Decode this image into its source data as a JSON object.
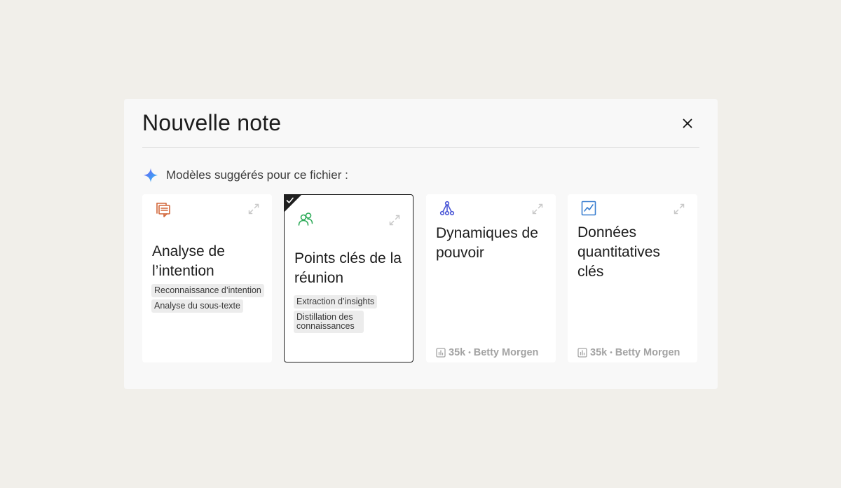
{
  "modal": {
    "title": "Nouvelle note",
    "close_icon": "close-icon"
  },
  "suggestions": {
    "icon": "sparkle-icon",
    "label": "Modèles suggérés pour ce fichier :"
  },
  "cards": [
    {
      "icon": "chat-list-icon",
      "icon_color": "#d2673a",
      "title": "Analyse de l’intention",
      "tags": [
        "Reconnaissance d’intention",
        "Analyse du sous-texte"
      ],
      "selected": false
    },
    {
      "icon": "people-icon",
      "icon_color": "#2fab5a",
      "title": "Points clés de la réunion",
      "tags": [
        "Extraction d’insights",
        "Distillation des connaissances"
      ],
      "selected": true
    },
    {
      "icon": "network-icon",
      "icon_color": "#4a56d6",
      "title": "Dynamiques de pouvoir",
      "meta_count": "35k",
      "meta_sep": "•",
      "meta_author": "Betty Morgen",
      "selected": false
    },
    {
      "icon": "line-chart-icon",
      "icon_color": "#3a7fd0",
      "title": "Données quantitatives clés",
      "meta_count": "35k",
      "meta_sep": "•",
      "meta_author": "Betty Morgen",
      "selected": false
    }
  ],
  "colors": {
    "background": "#f1efea",
    "modal": "#f8f8f8",
    "card": "#ffffff",
    "tag": "#ececec",
    "meta": "#a3a3a3"
  }
}
